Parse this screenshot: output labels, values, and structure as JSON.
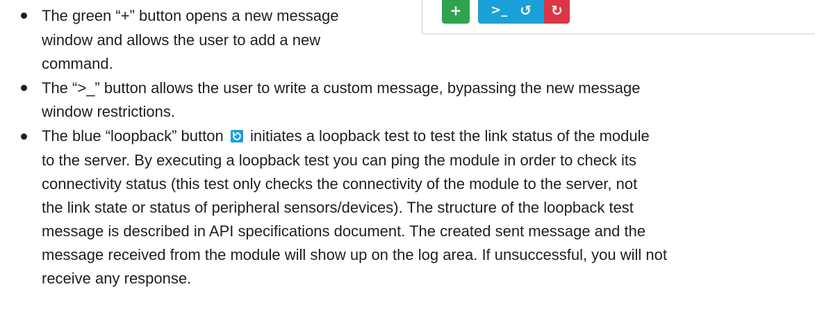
{
  "panel": {
    "buttons": {
      "add_label": "+",
      "custom_label": ">_",
      "loopback_label": "↺",
      "red_label": "↻"
    },
    "colors": {
      "add": "#2ea44f",
      "blue": "#1aa0d8",
      "red": "#dc3545"
    },
    "icons": {
      "loopback": "loopback-icon",
      "red": "reload-icon"
    }
  },
  "bullets": {
    "b1": {
      "line1": "The green “+” button opens a new message",
      "line2": "window and allows the user to add a new",
      "line3": "command."
    },
    "b2": {
      "line1": "The “>_” button allows the user to write a custom message, bypassing the new message",
      "line2": "window restrictions."
    },
    "b3": {
      "line1_a": "The blue “loopback” button",
      "line1_b": "initiates a loopback test to test the link status of the module",
      "line2": "to the server. By executing a loopback test you can ping the module in order to check its",
      "line3": "connectivity status (this test only checks the connectivity of the module to the server, not",
      "line4": "the link state or status of peripheral sensors/devices). The structure of the loopback test",
      "line5": "message is described in API specifications document. The created sent message and the",
      "line6": "message received from the module will show up on the log area. If unsuccessful, you will not",
      "line7": "receive any response."
    }
  }
}
